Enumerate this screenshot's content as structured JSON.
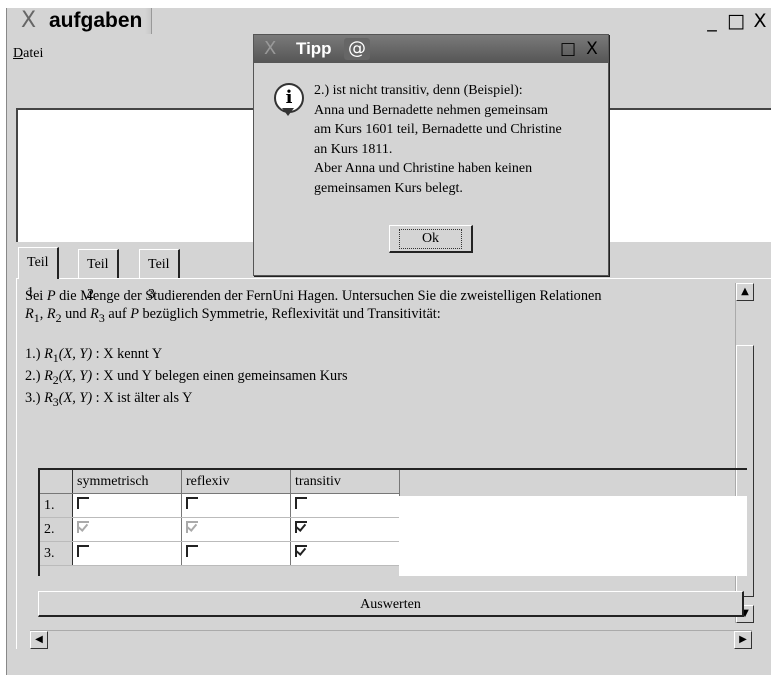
{
  "window": {
    "title_glyph": "X",
    "title": "aufgaben",
    "controls": {
      "minimize": "_",
      "maximize": "□",
      "close": "X"
    }
  },
  "menubar": {
    "items": [
      {
        "label": "Datei",
        "mnemonic": "D"
      }
    ]
  },
  "tabs": [
    {
      "label": "Teil 1",
      "active": true
    },
    {
      "label": "Teil 2",
      "active": false
    },
    {
      "label": "Teil 3",
      "active": false
    }
  ],
  "description": {
    "intro_line1_pre": "Sei ",
    "intro_var_P": "P",
    "intro_line1_post": " die Menge der Studierenden der FernUni Hagen. Untersuchen Sie die zweistelligen Relationen",
    "rel_R1": "R",
    "rel_sub_1": "1",
    "sep1": ", ",
    "rel_sub_2": "2",
    "and": " und ",
    "rel_sub_3": "3",
    "on": " auf ",
    "intro_line2_post": " bezüglich Symmetrie, Reflexivität und Transitivität:",
    "items": [
      {
        "num": "1.) ",
        "sub": "1",
        "args": "(X, Y)",
        "text": " : X kennt Y"
      },
      {
        "num": "2.) ",
        "sub": "2",
        "args": "(X, Y)",
        "text": " : X und Y belegen einen gemeinsamen Kurs"
      },
      {
        "num": "3.) ",
        "sub": "3",
        "args": "(X, Y)",
        "text": " : X ist älter als Y"
      }
    ]
  },
  "table": {
    "columns": [
      "symmetrisch",
      "reflexiv",
      "transitiv"
    ],
    "rows": [
      {
        "label": "1.",
        "symmetrisch": false,
        "reflexiv": false,
        "transitiv": false,
        "disabled": [
          false,
          false,
          false
        ]
      },
      {
        "label": "2.",
        "symmetrisch": true,
        "reflexiv": true,
        "transitiv": true,
        "disabled": [
          true,
          true,
          false
        ]
      },
      {
        "label": "3.",
        "symmetrisch": false,
        "reflexiv": false,
        "transitiv": true,
        "disabled": [
          false,
          false,
          false
        ]
      }
    ]
  },
  "buttons": {
    "evaluate": "Auswerten"
  },
  "scrollbar_icons": {
    "up": "up-arrow-icon",
    "down": "down-arrow-icon",
    "left": "left-arrow-icon",
    "right": "right-arrow-icon"
  },
  "dialog": {
    "title_glyph": "X",
    "title": "Tipp",
    "swirl_glyph": "@",
    "controls": {
      "maximize": "□",
      "close": "X"
    },
    "icon": "info-icon",
    "icon_glyph": "i",
    "message_lines": [
      "2.) ist nicht transitiv, denn (Beispiel):",
      "Anna und Bernadette nehmen gemeinsam",
      "am Kurs 1601 teil, Bernadette und Christine",
      "an Kurs 1811.",
      "Aber Anna und Christine haben keinen",
      "gemeinsamen Kurs belegt."
    ],
    "ok_label": "Ok"
  }
}
